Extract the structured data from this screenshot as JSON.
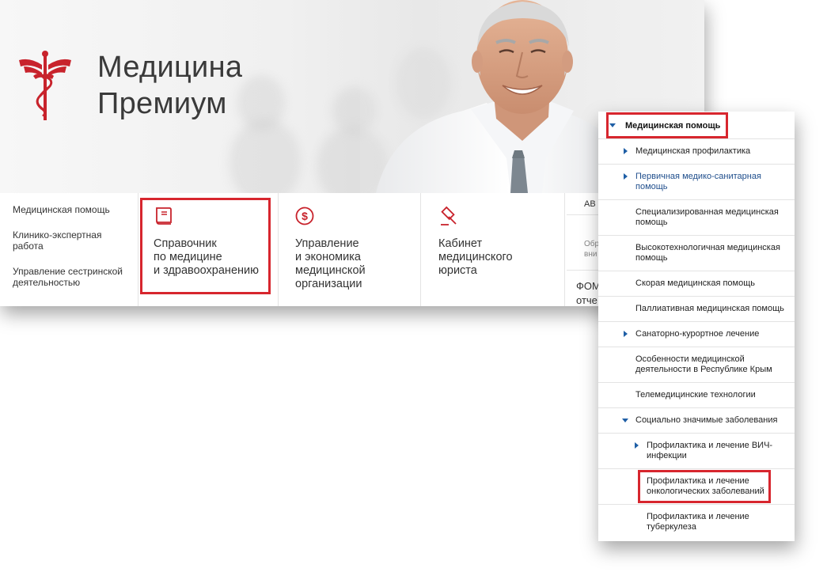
{
  "brand": {
    "name_line1": "Медицина",
    "name_line2": "Премиум",
    "color": "#c8232c"
  },
  "left_links": [
    "Медицинская помощь",
    "Клинико-экспертная работа",
    "Управление сестринской деятельностью"
  ],
  "cards": {
    "reference": {
      "title": "Справочник\nпо медицине\nи здравоохранению",
      "icon": "book-icon"
    },
    "management": {
      "title": "Управление\nи экономика\nмедицинской\nорганизации",
      "icon": "dollar-icon"
    },
    "lawyer": {
      "title": "Кабинет\nмедицинского\nюриста",
      "icon": "gavel-icon"
    },
    "cut": {
      "top": "АВ",
      "mid": "Обр\nвни",
      "bottom_1": "ФОМ",
      "bottom_2": "отче"
    }
  },
  "tree": {
    "root": "Медицинская помощь",
    "items": [
      {
        "label": "Медицинская профилактика",
        "arrow": "right"
      },
      {
        "label": "Первичная медико-санитарная помощь",
        "arrow": "right",
        "style": "blue"
      },
      {
        "label": "Специализированная медицинская помощь",
        "arrow": "none"
      },
      {
        "label": "Высокотехнологичная медицинская помощь",
        "arrow": "none"
      },
      {
        "label": "Скорая медицинская помощь",
        "arrow": "none"
      },
      {
        "label": "Паллиативная медицинская помощь",
        "arrow": "none"
      },
      {
        "label": "Санаторно-курортное лечение",
        "arrow": "right"
      },
      {
        "label": "Особенности медицинской деятельности в Республике Крым",
        "arrow": "none"
      },
      {
        "label": "Телемедицинские технологии",
        "arrow": "none"
      },
      {
        "label": "Социально значимые заболевания",
        "arrow": "down"
      }
    ],
    "sub_items": [
      {
        "label": "Профилактика и лечение ВИЧ-инфекции",
        "arrow": "right"
      },
      {
        "label": "Профилактика и лечение онкологических заболеваний",
        "arrow": "none"
      },
      {
        "label": "Профилактика и лечение туберкулеза",
        "arrow": "none"
      }
    ]
  },
  "colors": {
    "highlight": "#d7262e",
    "tree_arrow": "#1f5fa6",
    "link_blue": "#1f4e8c"
  }
}
